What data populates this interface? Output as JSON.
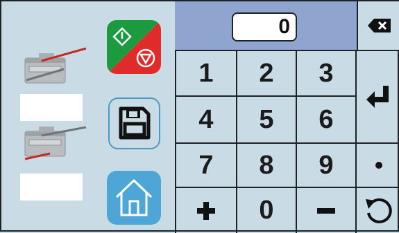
{
  "display": {
    "value": "0"
  },
  "keys": {
    "k1": "1",
    "k2": "2",
    "k3": "3",
    "k4": "4",
    "k5": "5",
    "k6": "6",
    "k7": "7",
    "k8": "8",
    "k9": "9",
    "k0": "0"
  },
  "icons": {
    "start_stop": "start-stop-icon",
    "save": "save-floppy-icon",
    "home": "home-icon",
    "backspace": "backspace-icon",
    "enter": "enter-icon",
    "decimal": "decimal-point-icon",
    "plus": "plus-icon",
    "minus": "minus-icon",
    "reset": "refresh-icon"
  },
  "colors": {
    "background": "#c9dce6",
    "display_row": "#8fa4cf",
    "start": "#1c9a3f",
    "stop": "#e02b2b",
    "home": "#4ea6d6",
    "save_border": "#4c98c6"
  }
}
